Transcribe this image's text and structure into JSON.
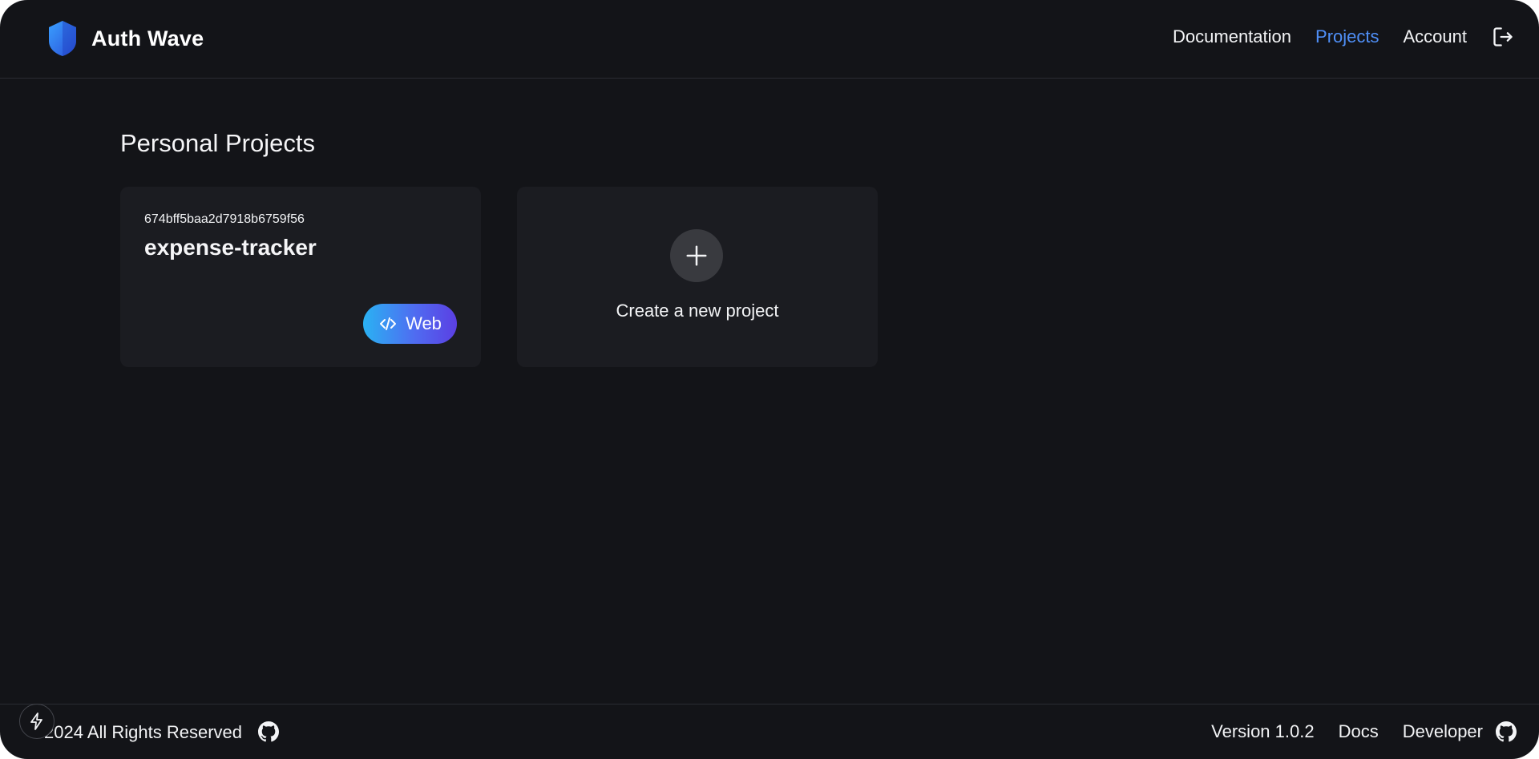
{
  "brand": {
    "name": "Auth Wave"
  },
  "nav": {
    "items": [
      {
        "label": "Documentation",
        "active": false
      },
      {
        "label": "Projects",
        "active": true
      },
      {
        "label": "Account",
        "active": false
      }
    ],
    "logout_icon": "logout-icon"
  },
  "main": {
    "title": "Personal Projects",
    "projects": [
      {
        "id": "674bff5baa2d7918b6759f56",
        "name": "expense-tracker",
        "platform": "Web",
        "platform_icon": "code-icon"
      }
    ],
    "create": {
      "label": "Create a new project",
      "icon": "plus-icon"
    }
  },
  "footer": {
    "copyright": "2024 All Rights Reserved",
    "version": "Version 1.0.2",
    "docs": "Docs",
    "developer": "Developer"
  },
  "colors": {
    "background": "#131418",
    "card": "#1b1c21",
    "accent": "#4f8ff7",
    "badge_gradient_start": "#2ab2f3",
    "badge_gradient_end": "#5b3fe3"
  }
}
